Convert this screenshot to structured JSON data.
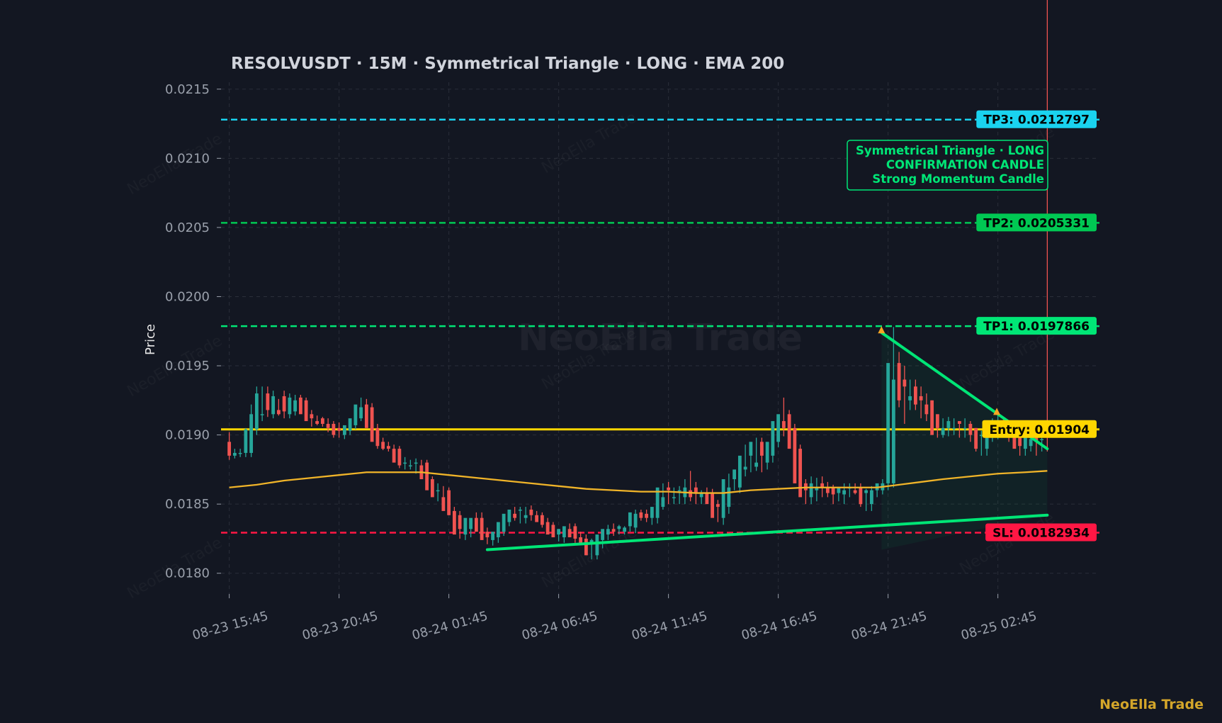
{
  "chart_data": {
    "type": "candlestick",
    "title": "RESOLVUSDT  ·  15M  ·  Symmetrical Triangle  ·  LONG  ·  EMA 200",
    "ylabel": "Price",
    "ylim": [
      0.01785,
      0.02155
    ],
    "yticks": [
      "0.0215",
      "0.0210",
      "0.0205",
      "0.0200",
      "0.0195",
      "0.0190",
      "0.0185",
      "0.0180"
    ],
    "ytick_values": [
      0.0215,
      0.021,
      0.0205,
      0.02,
      0.0195,
      0.019,
      0.0185,
      0.018
    ],
    "xticks": [
      {
        "label": "08-23 15:45",
        "index": 0
      },
      {
        "label": "08-23 20:45",
        "index": 20
      },
      {
        "label": "08-24 01:45",
        "index": 40
      },
      {
        "label": "08-24 06:45",
        "index": 60
      },
      {
        "label": "08-24 11:45",
        "index": 80
      },
      {
        "label": "08-24 16:45",
        "index": 100
      },
      {
        "label": "08-24 21:45",
        "index": 120
      },
      {
        "label": "08-25 02:45",
        "index": 140
      }
    ],
    "x_range": [
      -1.5,
      158.5
    ],
    "grid": true,
    "candles": {
      "open": [
        0.01895,
        0.01885,
        0.01887,
        0.01887,
        0.01887,
        0.01904,
        0.01915,
        0.0193,
        0.01915,
        0.01918,
        0.01928,
        0.01915,
        0.01917,
        0.01927,
        0.01925,
        0.01915,
        0.0191,
        0.01912,
        0.01908,
        0.01908,
        0.01905,
        0.019,
        0.01903,
        0.01907,
        0.01912,
        0.01922,
        0.0192,
        0.01905,
        0.01895,
        0.01892,
        0.0189,
        0.0189,
        0.0188,
        0.01878,
        0.0188,
        0.01878,
        0.0188,
        0.01868,
        0.0186,
        0.01855,
        0.0186,
        0.01845,
        0.01842,
        0.01828,
        0.01832,
        0.0184,
        0.0184,
        0.0183,
        0.01824,
        0.01826,
        0.0183,
        0.01837,
        0.01843,
        0.01846,
        0.0184,
        0.01846,
        0.01842,
        0.01842,
        0.01837,
        0.01835,
        0.01828,
        0.01826,
        0.01832,
        0.01834,
        0.01826,
        0.01825,
        0.01822,
        0.01813,
        0.01824,
        0.01828,
        0.01832,
        0.01832,
        0.0183,
        0.01834,
        0.01833,
        0.01844,
        0.01843,
        0.0184,
        0.0184,
        0.01848,
        0.01862,
        0.01855,
        0.0186,
        0.01855,
        0.0186,
        0.01862,
        0.01855,
        0.01858,
        0.01858,
        0.0185,
        0.0184,
        0.01848,
        0.01868,
        0.01862,
        0.01875,
        0.01885,
        0.01877,
        0.01895,
        0.0188,
        0.01885,
        0.01895,
        0.0191,
        0.01915,
        0.01905,
        0.0189,
        0.01865,
        0.01855,
        0.0186,
        0.01865,
        0.01862,
        0.01862,
        0.01858,
        0.01857,
        0.01862,
        0.0186,
        0.01862,
        0.01858,
        0.0185,
        0.0186,
        0.0186,
        0.01865,
        0.01865,
        0.01952,
        0.0194,
        0.01925,
        0.01935,
        0.01928,
        0.01922,
        0.01925,
        0.01915,
        0.019,
        0.01905,
        0.01905,
        0.0191,
        0.01905,
        0.01908,
        0.01905,
        0.019,
        0.0189,
        0.019,
        0.01905,
        0.01908,
        0.01905,
        0.019,
        0.019,
        0.0189,
        0.01892,
        0.019,
        0.01897,
        0.01895
      ],
      "high": [
        0.01902,
        0.0189,
        0.0189,
        0.01905,
        0.01922,
        0.01935,
        0.01935,
        0.01935,
        0.01932,
        0.01926,
        0.01932,
        0.0193,
        0.01929,
        0.01929,
        0.01927,
        0.01918,
        0.01914,
        0.01913,
        0.01912,
        0.0191,
        0.01909,
        0.01906,
        0.0191,
        0.0192,
        0.01927,
        0.01926,
        0.01923,
        0.01908,
        0.01898,
        0.01895,
        0.01893,
        0.01892,
        0.01884,
        0.01882,
        0.01883,
        0.01882,
        0.01882,
        0.0187,
        0.01865,
        0.01863,
        0.01862,
        0.01848,
        0.01845,
        0.01833,
        0.01838,
        0.01844,
        0.01844,
        0.01833,
        0.01828,
        0.01831,
        0.01838,
        0.01845,
        0.01848,
        0.01848,
        0.01848,
        0.01849,
        0.01845,
        0.01844,
        0.0184,
        0.01837,
        0.01832,
        0.0183,
        0.01836,
        0.01836,
        0.0183,
        0.01828,
        0.01825,
        0.01826,
        0.0183,
        0.01835,
        0.01836,
        0.01835,
        0.01834,
        0.01836,
        0.01846,
        0.01846,
        0.01846,
        0.01843,
        0.0185,
        0.01865,
        0.01866,
        0.01862,
        0.01863,
        0.01868,
        0.01874,
        0.01866,
        0.0186,
        0.01862,
        0.01861,
        0.01853,
        0.0185,
        0.01872,
        0.01873,
        0.0188,
        0.01893,
        0.0189,
        0.01898,
        0.01898,
        0.0189,
        0.019,
        0.01914,
        0.01927,
        0.01918,
        0.01908,
        0.01893,
        0.01868,
        0.0187,
        0.01869,
        0.0187,
        0.01866,
        0.01864,
        0.01861,
        0.01865,
        0.01865,
        0.01865,
        0.01865,
        0.01861,
        0.01863,
        0.01863,
        0.01868,
        0.01868,
        0.01978,
        0.0196,
        0.0195,
        0.0194,
        0.0194,
        0.01935,
        0.0193,
        0.01925,
        0.0191,
        0.01912,
        0.01913,
        0.01912,
        0.0191,
        0.01912,
        0.0191,
        0.01905,
        0.01903,
        0.0191,
        0.01912,
        0.01914,
        0.01911,
        0.01905,
        0.01902,
        0.01895,
        0.01902,
        0.01905,
        0.01902,
        0.01898
      ],
      "low": [
        0.01882,
        0.01883,
        0.01884,
        0.01884,
        0.01884,
        0.019,
        0.0191,
        0.01913,
        0.01912,
        0.01914,
        0.01912,
        0.01912,
        0.01914,
        0.0192,
        0.01912,
        0.01906,
        0.01907,
        0.01906,
        0.01902,
        0.01898,
        0.01898,
        0.01897,
        0.019,
        0.01904,
        0.0191,
        0.01917,
        0.01902,
        0.0189,
        0.01889,
        0.01888,
        0.01887,
        0.01876,
        0.01875,
        0.01875,
        0.01872,
        0.01874,
        0.01865,
        0.01857,
        0.01852,
        0.01852,
        0.01842,
        0.01838,
        0.01825,
        0.01824,
        0.01826,
        0.01836,
        0.01827,
        0.01821,
        0.0182,
        0.01822,
        0.01827,
        0.01834,
        0.01838,
        0.01836,
        0.01836,
        0.01838,
        0.01838,
        0.01833,
        0.01831,
        0.01826,
        0.01823,
        0.01822,
        0.01827,
        0.01822,
        0.01822,
        0.01818,
        0.0181,
        0.0181,
        0.01818,
        0.01824,
        0.01827,
        0.01828,
        0.01828,
        0.0183,
        0.01829,
        0.01838,
        0.01837,
        0.01835,
        0.01836,
        0.01846,
        0.0185,
        0.0185,
        0.0185,
        0.0185,
        0.01852,
        0.0185,
        0.0185,
        0.01853,
        0.01845,
        0.01837,
        0.01835,
        0.01843,
        0.0186,
        0.01858,
        0.0187,
        0.01873,
        0.01874,
        0.01873,
        0.01875,
        0.0188,
        0.01891,
        0.01899,
        0.019,
        0.01885,
        0.01862,
        0.0185,
        0.0185,
        0.01852,
        0.01855,
        0.01855,
        0.0185,
        0.01852,
        0.0185,
        0.01855,
        0.01857,
        0.01848,
        0.01845,
        0.01845,
        0.01855,
        0.01857,
        0.0186,
        0.01862,
        0.0192,
        0.01908,
        0.01918,
        0.01918,
        0.01912,
        0.0191,
        0.01908,
        0.01898,
        0.01898,
        0.01899,
        0.019,
        0.01898,
        0.01898,
        0.01895,
        0.01888,
        0.01885,
        0.01885,
        0.01895,
        0.01897,
        0.01898,
        0.01895,
        0.01892,
        0.01885,
        0.01885,
        0.01888,
        0.01885,
        0.01888,
        0.01888
      ],
      "close": [
        0.01885,
        0.01887,
        0.01887,
        0.01904,
        0.01915,
        0.0193,
        0.01915,
        0.01918,
        0.01928,
        0.01915,
        0.01917,
        0.01927,
        0.01925,
        0.01915,
        0.0191,
        0.01912,
        0.01908,
        0.01908,
        0.01905,
        0.019,
        0.01903,
        0.01907,
        0.01912,
        0.01922,
        0.0192,
        0.01905,
        0.01895,
        0.01892,
        0.0189,
        0.0189,
        0.0188,
        0.01878,
        0.0188,
        0.01878,
        0.0188,
        0.01868,
        0.0186,
        0.01855,
        0.0186,
        0.01845,
        0.01842,
        0.01828,
        0.01832,
        0.0184,
        0.0184,
        0.0183,
        0.01824,
        0.01826,
        0.0183,
        0.01837,
        0.01843,
        0.01846,
        0.0184,
        0.01846,
        0.01842,
        0.01842,
        0.01837,
        0.01835,
        0.01828,
        0.01826,
        0.01832,
        0.01834,
        0.01826,
        0.01825,
        0.01822,
        0.01813,
        0.01824,
        0.01828,
        0.01832,
        0.01832,
        0.0183,
        0.01834,
        0.01833,
        0.01844,
        0.01843,
        0.0184,
        0.0184,
        0.01848,
        0.01862,
        0.01855,
        0.0186,
        0.01855,
        0.0186,
        0.01862,
        0.01855,
        0.01858,
        0.01858,
        0.0185,
        0.0184,
        0.01848,
        0.01868,
        0.01862,
        0.01875,
        0.01885,
        0.01877,
        0.01895,
        0.0188,
        0.01885,
        0.01895,
        0.0191,
        0.01915,
        0.01905,
        0.0189,
        0.01865,
        0.01855,
        0.0186,
        0.01865,
        0.01862,
        0.01862,
        0.01858,
        0.01857,
        0.01862,
        0.0186,
        0.01862,
        0.01858,
        0.0185,
        0.0186,
        0.0186,
        0.01865,
        0.01865,
        0.01952,
        0.0194,
        0.01925,
        0.01935,
        0.01928,
        0.01922,
        0.01925,
        0.01915,
        0.019,
        0.01905,
        0.01905,
        0.0191,
        0.01905,
        0.01908,
        0.01905,
        0.019,
        0.0189,
        0.019,
        0.01905,
        0.01908,
        0.01905,
        0.019,
        0.019,
        0.0189,
        0.01892,
        0.019,
        0.01897,
        0.01895,
        0.01897
      ]
    },
    "ema200": [
      [
        0,
        0.01862
      ],
      [
        5,
        0.01864
      ],
      [
        10,
        0.01867
      ],
      [
        15,
        0.01869
      ],
      [
        20,
        0.01871
      ],
      [
        25,
        0.01873
      ],
      [
        30,
        0.01873
      ],
      [
        35,
        0.01873
      ],
      [
        40,
        0.01871
      ],
      [
        45,
        0.01869
      ],
      [
        50,
        0.01867
      ],
      [
        55,
        0.01865
      ],
      [
        60,
        0.01863
      ],
      [
        65,
        0.01861
      ],
      [
        70,
        0.0186
      ],
      [
        75,
        0.01859
      ],
      [
        80,
        0.01859
      ],
      [
        85,
        0.01858
      ],
      [
        90,
        0.01858
      ],
      [
        95,
        0.0186
      ],
      [
        100,
        0.01861
      ],
      [
        105,
        0.01862
      ],
      [
        110,
        0.01862
      ],
      [
        115,
        0.01862
      ],
      [
        118,
        0.01862
      ],
      [
        122,
        0.01864
      ],
      [
        126,
        0.01866
      ],
      [
        130,
        0.01868
      ],
      [
        135,
        0.0187
      ],
      [
        140,
        0.01872
      ],
      [
        145,
        0.01873
      ],
      [
        149,
        0.01874
      ]
    ],
    "triangle": {
      "upper": [
        [
          118.8,
          0.01974
        ],
        [
          149,
          0.0189
        ]
      ],
      "lower": [
        [
          47,
          0.01817
        ],
        [
          149,
          0.01842
        ]
      ],
      "fill": [
        [
          118.8,
          0.01974
        ],
        [
          149,
          0.0189
        ],
        [
          149,
          0.01842
        ],
        [
          118.8,
          0.01817
        ]
      ],
      "markers": [
        [
          118.8,
          0.01976
        ],
        [
          139.8,
          0.01917
        ]
      ]
    },
    "levels": [
      {
        "name": "TP3",
        "label": "TP3: 0.0212797",
        "value": 0.0212797,
        "color": "#1ad3ef",
        "style": "dashed"
      },
      {
        "name": "TP2",
        "label": "TP2: 0.0205331",
        "value": 0.0205331,
        "color": "#00c853",
        "style": "dashed"
      },
      {
        "name": "TP1",
        "label": "TP1: 0.0197866",
        "value": 0.0197866,
        "color": "#00e676",
        "style": "dashed"
      },
      {
        "name": "Entry",
        "label": "Entry: 0.01904",
        "value": 0.01904,
        "color": "#ffd600",
        "style": "solid"
      },
      {
        "name": "SL",
        "label": "SL: 0.0182934",
        "value": 0.0182934,
        "color": "#ff1744",
        "style": "dashed"
      }
    ],
    "annotation": {
      "lines": [
        "Symmetrical Triangle · LONG",
        "CONFIRMATION CANDLE",
        "Strong Momentum Candle"
      ],
      "color": "#00e676"
    },
    "watermark": "NeoElla Trade",
    "brand": "NeoElla Trade",
    "colors": {
      "up": "#26a69a",
      "down": "#ef5350",
      "ema": "#f0b429",
      "triangle": "#00e676",
      "background": "#131722",
      "grid": "#2a2e39"
    }
  }
}
